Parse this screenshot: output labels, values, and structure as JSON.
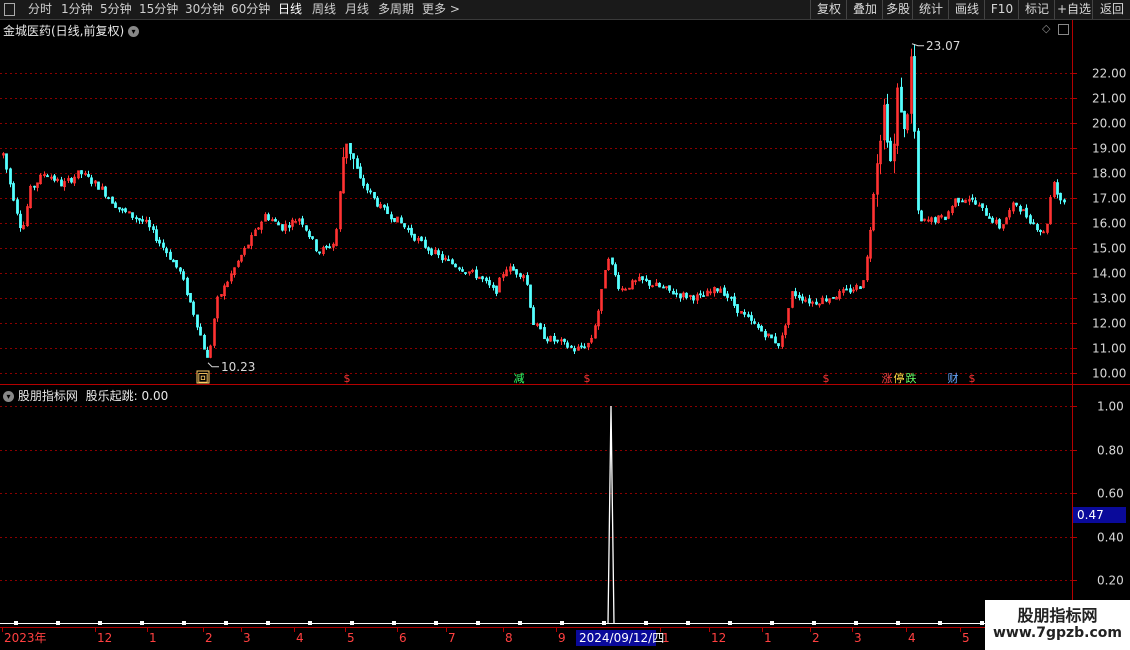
{
  "toolbar": {
    "periods": [
      {
        "label": "分时",
        "active": false
      },
      {
        "label": "1分钟",
        "active": false
      },
      {
        "label": "5分钟",
        "active": false
      },
      {
        "label": "15分钟",
        "active": false
      },
      {
        "label": "30分钟",
        "active": false
      },
      {
        "label": "60分钟",
        "active": false
      },
      {
        "label": "日线",
        "active": true
      },
      {
        "label": "周线",
        "active": false
      },
      {
        "label": "月线",
        "active": false
      },
      {
        "label": "多周期",
        "active": false
      },
      {
        "label": "更多 >",
        "active": false
      }
    ],
    "right_buttons": [
      "复权",
      "叠加",
      "多股",
      "统计",
      "画线",
      "F10",
      "标记",
      "+自选",
      "返回"
    ]
  },
  "main_chart": {
    "title": "金城医药(日线,前复权)",
    "price_labels": [
      "22.00",
      "21.00",
      "20.00",
      "19.00",
      "18.00",
      "17.00",
      "16.00",
      "15.00",
      "14.00",
      "13.00",
      "12.00",
      "11.00",
      "10.00"
    ],
    "max_label": "23.07",
    "min_label": "10.23",
    "event_markers": [
      {
        "text": "回",
        "color": "#ffcc66",
        "box": true
      },
      {
        "text": "$",
        "color": "#ff3333",
        "box": false
      },
      {
        "text": "减",
        "color": "#33ff66",
        "box": false
      },
      {
        "text": "$",
        "color": "#ff3333",
        "box": false
      },
      {
        "text": "$",
        "color": "#ff3333",
        "box": false
      },
      {
        "text": "涨",
        "color": "#ff4444",
        "box": false
      },
      {
        "text": "停",
        "color": "#ffdd44",
        "box": false
      },
      {
        "text": "跌",
        "color": "#66ff66",
        "box": false
      },
      {
        "text": "财",
        "color": "#66aaff",
        "box": false
      },
      {
        "text": "$",
        "color": "#ff3333",
        "box": false
      }
    ],
    "colors": {
      "up": "#ff3232",
      "down": "#54ffff",
      "grid": "#8a0000",
      "axis": "#b40000"
    }
  },
  "indicator": {
    "title": "股朋指标网",
    "series_label": "股乐起跳: 0.00",
    "y_labels": [
      "1.00",
      "0.80",
      "0.60",
      "0.40",
      "0.20"
    ],
    "cursor_value": "0.47"
  },
  "time_axis": {
    "labels": [
      "2023年",
      "12",
      "1",
      "2",
      "3",
      "4",
      "5",
      "6",
      "7",
      "8",
      "9",
      "1",
      "12",
      "1",
      "2",
      "3",
      "4",
      "5"
    ],
    "highlight": "2024/09/12/四"
  },
  "watermark": {
    "line1": "股朋指标网",
    "line2": "www.7gpzb.com"
  }
}
